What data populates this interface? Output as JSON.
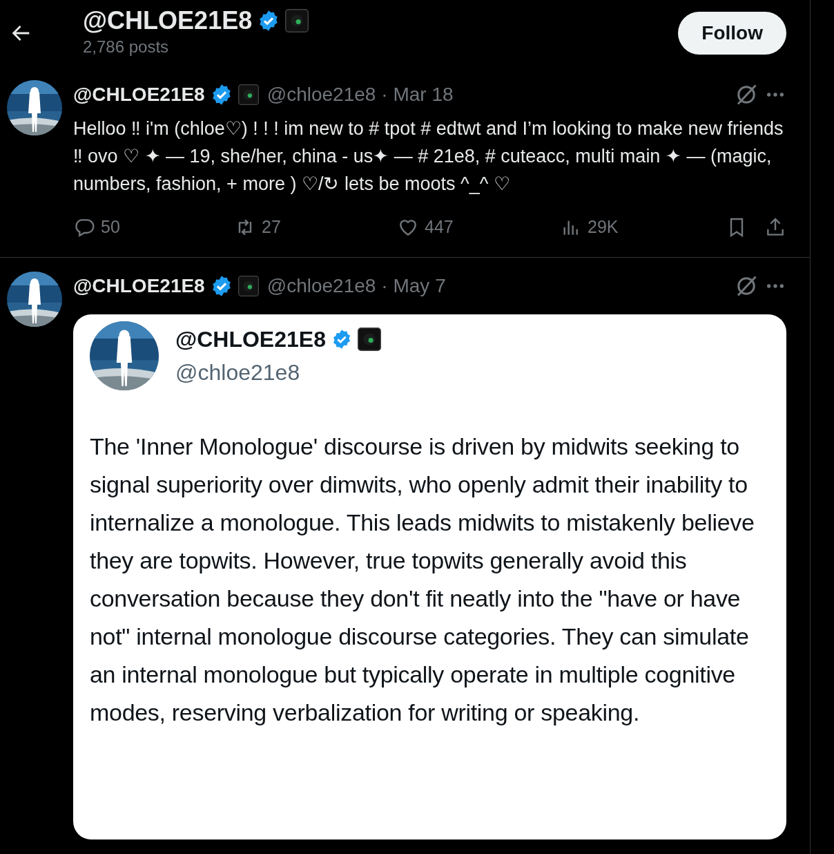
{
  "header": {
    "title": "@CHLOE21E8",
    "posts": "2,786 posts"
  },
  "follow_button": "Follow",
  "posts": [
    {
      "name": "@CHLOE21E8",
      "handle": "@chloe21e8",
      "date": "· Mar 18",
      "text": "Helloo ‼ i'm (chloe♡) ! ! !  im new to # tpot # edtwt and I’m looking to make new friends ‼ ovo ♡  ✦ — 19,  she/her,  china - us✦  —  # 21e8, # cuteacc, multi main ✦ — (magic, numbers, fashion, + more ) ♡/↻ lets be moots ^_^ ♡",
      "stats": {
        "replies": "50",
        "reposts": "27",
        "likes": "447",
        "views": "29K"
      }
    },
    {
      "name": "@CHLOE21E8",
      "handle": "@chloe21e8",
      "date": "· May 7",
      "quote": {
        "name": "@CHLOE21E8",
        "handle": "@chloe21e8",
        "text": "The 'Inner Monologue' discourse is driven by midwits seeking to signal superiority over dimwits, who openly admit their inability to internalize a monologue. This leads midwits to mistakenly believe they are topwits. However, true topwits generally avoid this conversation because they don't fit neatly into the \"have or have not\" internal monologue discourse categories. They can simulate an internal monologue but typically operate in multiple cognitive modes, reserving verbalization for writing or speaking."
      }
    }
  ]
}
